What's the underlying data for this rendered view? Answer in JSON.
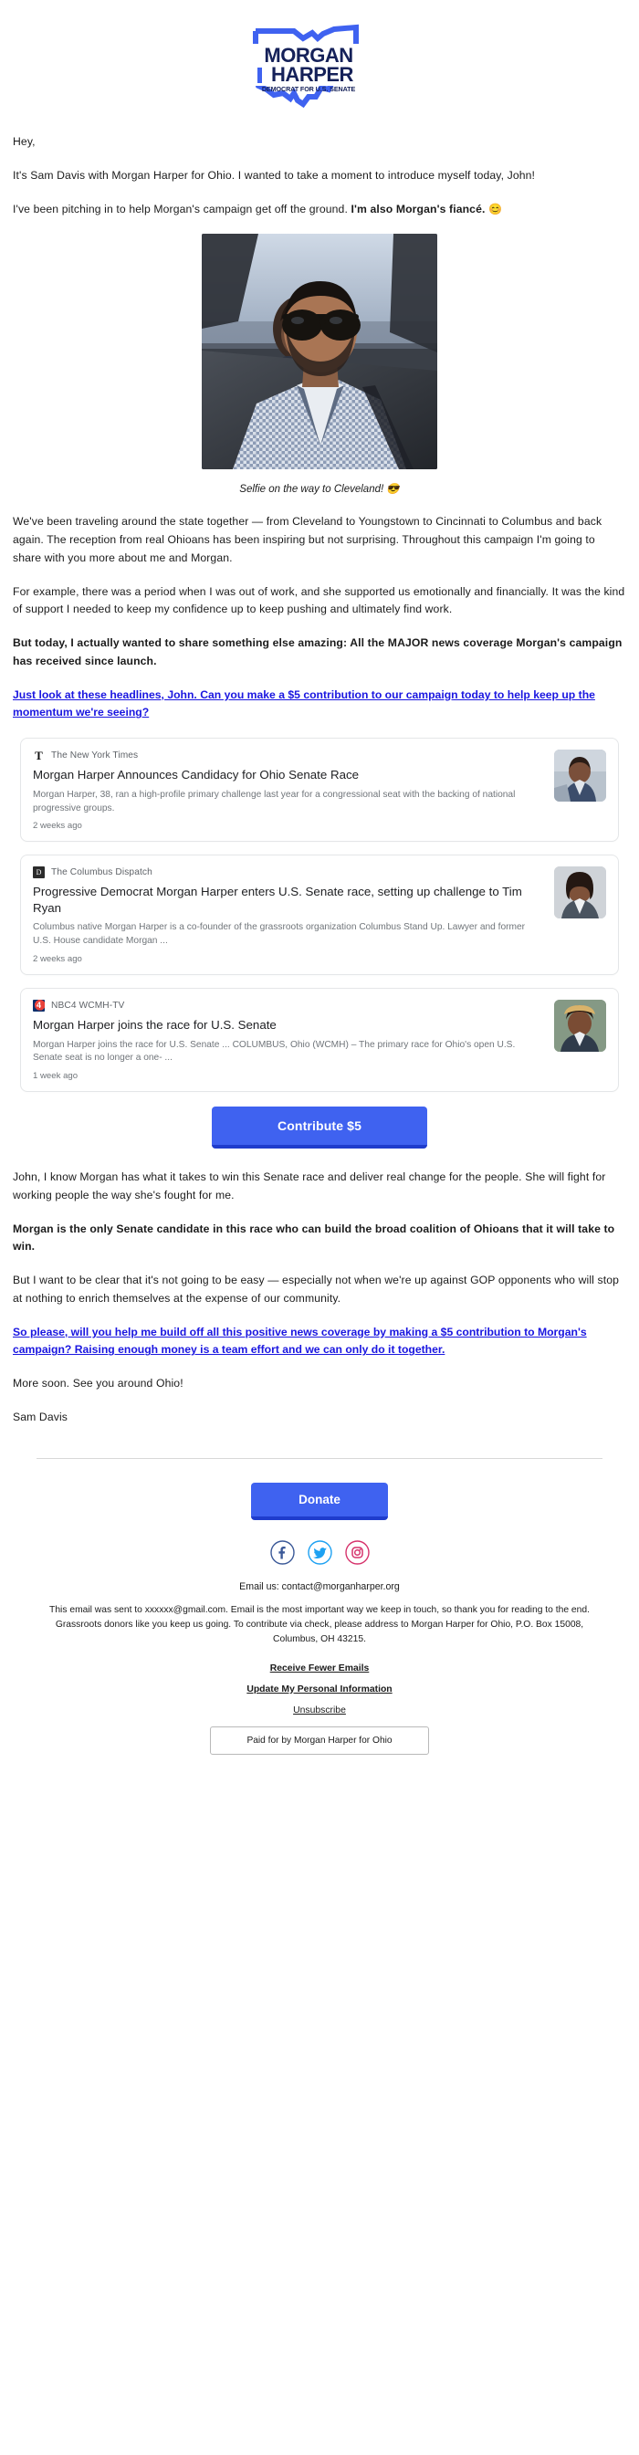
{
  "logo": {
    "line1": "MORGAN",
    "line2": "HARPER",
    "tagline": "DEMOCRAT FOR U.S. SENATE",
    "brand_navy": "#152159",
    "brand_blue": "#3f62f0"
  },
  "body": {
    "greeting": "Hey,",
    "p1": "It's Sam Davis with Morgan Harper for Ohio. I wanted to take a moment to introduce myself today, John!",
    "p2_pre": "I've been pitching in to help Morgan's campaign get off the ground. ",
    "p2_bold": "I'm also Morgan's fiancé.",
    "p2_emoji": "😊",
    "caption": "Selfie on the way to Cleveland! 😎",
    "p3": "We've been traveling around the state together — from Cleveland to Youngstown to Cincinnati to Columbus and back again. The reception from real Ohioans has been inspiring but not surprising. Throughout this campaign I'm going to share with you more about me and Morgan.",
    "p4": "For example, there was a period when I was out of work, and she supported us emotionally and financially. It was the kind of support I needed to keep my confidence up to keep pushing and ultimately find work.",
    "p5_bold": "But today, I actually wanted to share something else amazing: All the MAJOR news coverage Morgan's campaign has received since launch.",
    "ask_link": "Just look at these headlines, John. Can you make a $5 contribution to our campaign today to help keep up the momentum we're seeing?",
    "p6": "John, I know Morgan has what it takes to win this Senate race and deliver real change for the people. She will fight for working people the way she's fought for me.",
    "p7_bold": "Morgan is the only Senate candidate in this race who can build the broad coalition of Ohioans that it will take to win.",
    "p8": "But I want to be clear that it's not going to be easy — especially not when we're up against GOP opponents who will stop at nothing to enrich themselves at the expense of our community.",
    "final_link": "So please, will you help me build off all this positive news coverage by making a $5 contribution to Morgan's campaign? Raising enough money is a team effort and we can only do it together.",
    "p9": "More soon. See you around Ohio!",
    "signoff": "Sam Davis"
  },
  "cta": {
    "label": "Contribute $5",
    "color": "#3f62f0"
  },
  "news_cards": [
    {
      "source": "The New York Times",
      "source_icon": "nyt-logo-icon",
      "title": "Morgan Harper Announces Candidacy for Ohio Senate Race",
      "snippet": "Morgan Harper, 38, ran a high-profile primary challenge last year for a congressional seat with the backing of national progressive groups.",
      "time": "2 weeks ago"
    },
    {
      "source": "The Columbus Dispatch",
      "source_icon": "columbus-dispatch-logo-icon",
      "title": "Progressive Democrat Morgan Harper enters U.S. Senate race, setting up challenge to Tim Ryan",
      "snippet": "Columbus native Morgan Harper is a co-founder of the grassroots organization Columbus Stand Up. Lawyer and former U.S. House candidate Morgan ...",
      "time": "2 weeks ago"
    },
    {
      "source": "NBC4 WCMH-TV",
      "source_icon": "nbc4-logo-icon",
      "title": "Morgan Harper joins the race for U.S. Senate",
      "snippet": "Morgan Harper joins the race for U.S. Senate ... COLUMBUS, Ohio (WCMH) – The primary race for Ohio's open U.S. Senate seat is no longer a one- ...",
      "time": "1 week ago"
    }
  ],
  "footer": {
    "donate_label": "Donate",
    "socials": [
      {
        "name": "facebook-icon",
        "glyph": "f",
        "color": "#3b5998"
      },
      {
        "name": "twitter-icon",
        "glyph": "t",
        "color": "#1da1f2"
      },
      {
        "name": "instagram-icon",
        "glyph": "i",
        "color": "#d6336c"
      }
    ],
    "email_us": "Email us: contact@morganharper.org",
    "legal": "This email was sent to xxxxxx@gmail.com. Email is the most important way we keep in touch, so thank you for reading to the end. Grassroots donors like you keep us going. To contribute via check, please address to Morgan Harper for Ohio, P.O. Box 15008, Columbus, OH 43215.",
    "link_receive_fewer": "Receive Fewer Emails",
    "link_update_info": "Update My Personal Information",
    "link_unsubscribe": "Unsubscribe",
    "paid_for": "Paid for by Morgan Harper for Ohio"
  }
}
